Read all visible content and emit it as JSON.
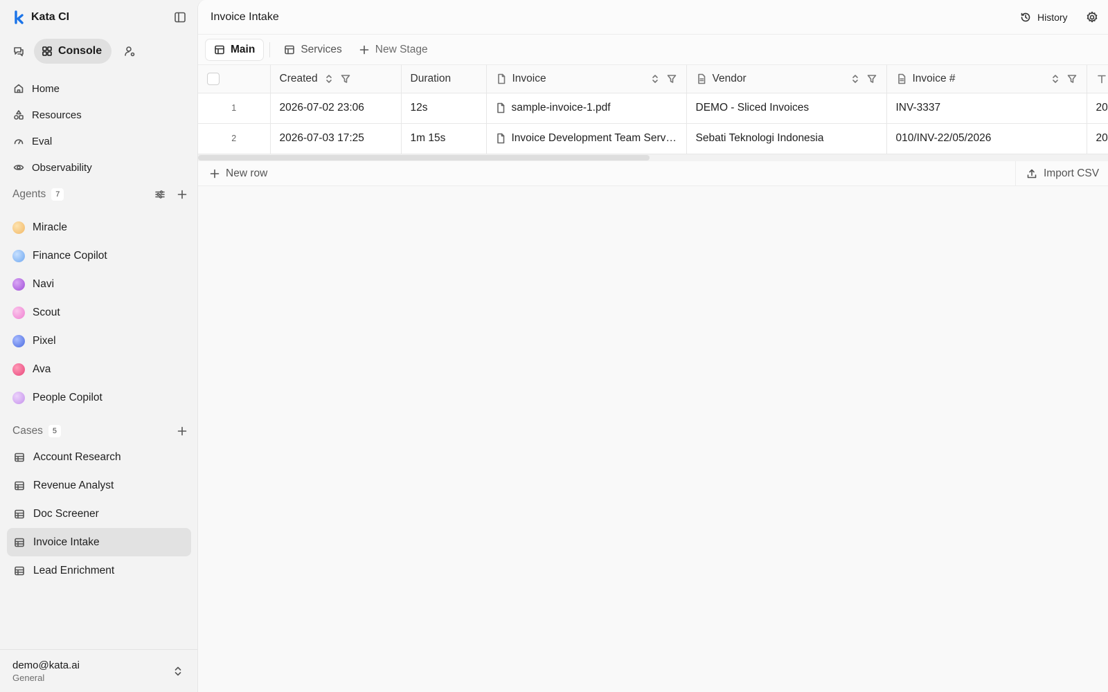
{
  "app": {
    "name": "Kata CI",
    "accent": "#1a73e8"
  },
  "modes": {
    "console_label": "Console"
  },
  "nav": [
    {
      "label": "Home",
      "icon": "home-icon"
    },
    {
      "label": "Resources",
      "icon": "shapes-icon"
    },
    {
      "label": "Eval",
      "icon": "gauge-icon"
    },
    {
      "label": "Observability",
      "icon": "eye-icon"
    }
  ],
  "agents": {
    "title": "Agents",
    "count": "7",
    "items": [
      {
        "label": "Miracle",
        "color": "#f2b866"
      },
      {
        "label": "Finance Copilot",
        "color": "#6fa8f0"
      },
      {
        "label": "Navi",
        "color": "#a04fd8"
      },
      {
        "label": "Scout",
        "color": "#ee7ed0"
      },
      {
        "label": "Pixel",
        "color": "#4a6be0"
      },
      {
        "label": "Ava",
        "color": "#e8467a"
      },
      {
        "label": "People Copilot",
        "color": "#c592ec"
      }
    ]
  },
  "cases": {
    "title": "Cases",
    "count": "5",
    "items": [
      {
        "label": "Account Research",
        "active": false
      },
      {
        "label": "Revenue Analyst",
        "active": false
      },
      {
        "label": "Doc Screener",
        "active": false
      },
      {
        "label": "Invoice Intake",
        "active": true
      },
      {
        "label": "Lead Enrichment",
        "active": false
      }
    ]
  },
  "user": {
    "email": "demo@kata.ai",
    "workspace": "General"
  },
  "page": {
    "title": "Invoice Intake",
    "history_label": "History"
  },
  "tabs": {
    "main": "Main",
    "services": "Services",
    "new_stage": "New Stage"
  },
  "table": {
    "columns": [
      "Created",
      "Duration",
      "Invoice",
      "Vendor",
      "Invoice #"
    ],
    "rows": [
      {
        "num": "1",
        "created": "2026-07-02 23:06",
        "duration": "12s",
        "invoice": "sample-invoice-1.pdf",
        "vendor": "DEMO - Sliced Invoices",
        "invoice_no": "INV-3337",
        "next": "20"
      },
      {
        "num": "2",
        "created": "2026-07-03 17:25",
        "duration": "1m 15s",
        "invoice": "Invoice Development Team Serv…",
        "vendor": "Sebati Teknologi Indonesia",
        "invoice_no": "010/INV-22/05/2026",
        "next": "20"
      }
    ],
    "footer": {
      "new_row": "New row",
      "import_csv": "Import CSV"
    }
  }
}
